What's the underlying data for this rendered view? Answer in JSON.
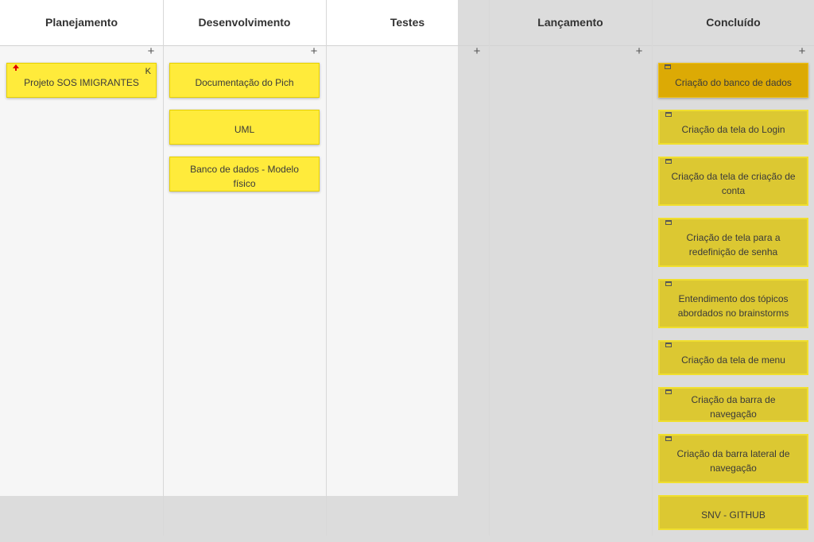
{
  "columns": [
    {
      "title": "Planejamento",
      "add": "+",
      "cards": [
        {
          "label": "Projeto SOS IMIGRANTES",
          "corner": "K",
          "icon": "priority-up-icon"
        }
      ]
    },
    {
      "title": "Desenvolvimento",
      "add": "+",
      "cards": [
        {
          "label": "Documentação do Pich"
        },
        {
          "label": "UML"
        },
        {
          "label": "Banco de dados - Modelo físico"
        }
      ]
    },
    {
      "title": "Testes",
      "add": "+",
      "cards": []
    },
    {
      "title": "Lançamento",
      "add": "+",
      "cards": []
    },
    {
      "title": "Concluído",
      "add": "+",
      "cards": [
        {
          "label": "Criação do banco de dados",
          "icon": "calendar-icon"
        },
        {
          "label": "Criação da tela do Login",
          "icon": "calendar-icon"
        },
        {
          "label": "Criação da tela de criação de conta",
          "icon": "calendar-icon"
        },
        {
          "label": "Criação de tela para a redefinição de senha",
          "icon": "calendar-icon"
        },
        {
          "label": "Entendimento dos tópicos abordados no brainstorms",
          "icon": "calendar-icon"
        },
        {
          "label": "Criação da tela de menu",
          "icon": "calendar-icon"
        },
        {
          "label": "Criação da barra de navegação",
          "icon": "calendar-icon"
        },
        {
          "label": "Criação da barra lateral de navegação",
          "icon": "calendar-icon"
        },
        {
          "label": "SNV - GITHUB"
        }
      ]
    }
  ],
  "colors": {
    "card": "#ffeb3b",
    "card_done": "#dcc832",
    "card_active": "#dcaa05",
    "panel_light": "#f6f6f6",
    "header_light": "#ffffff",
    "backdrop": "#dcdcdc"
  }
}
